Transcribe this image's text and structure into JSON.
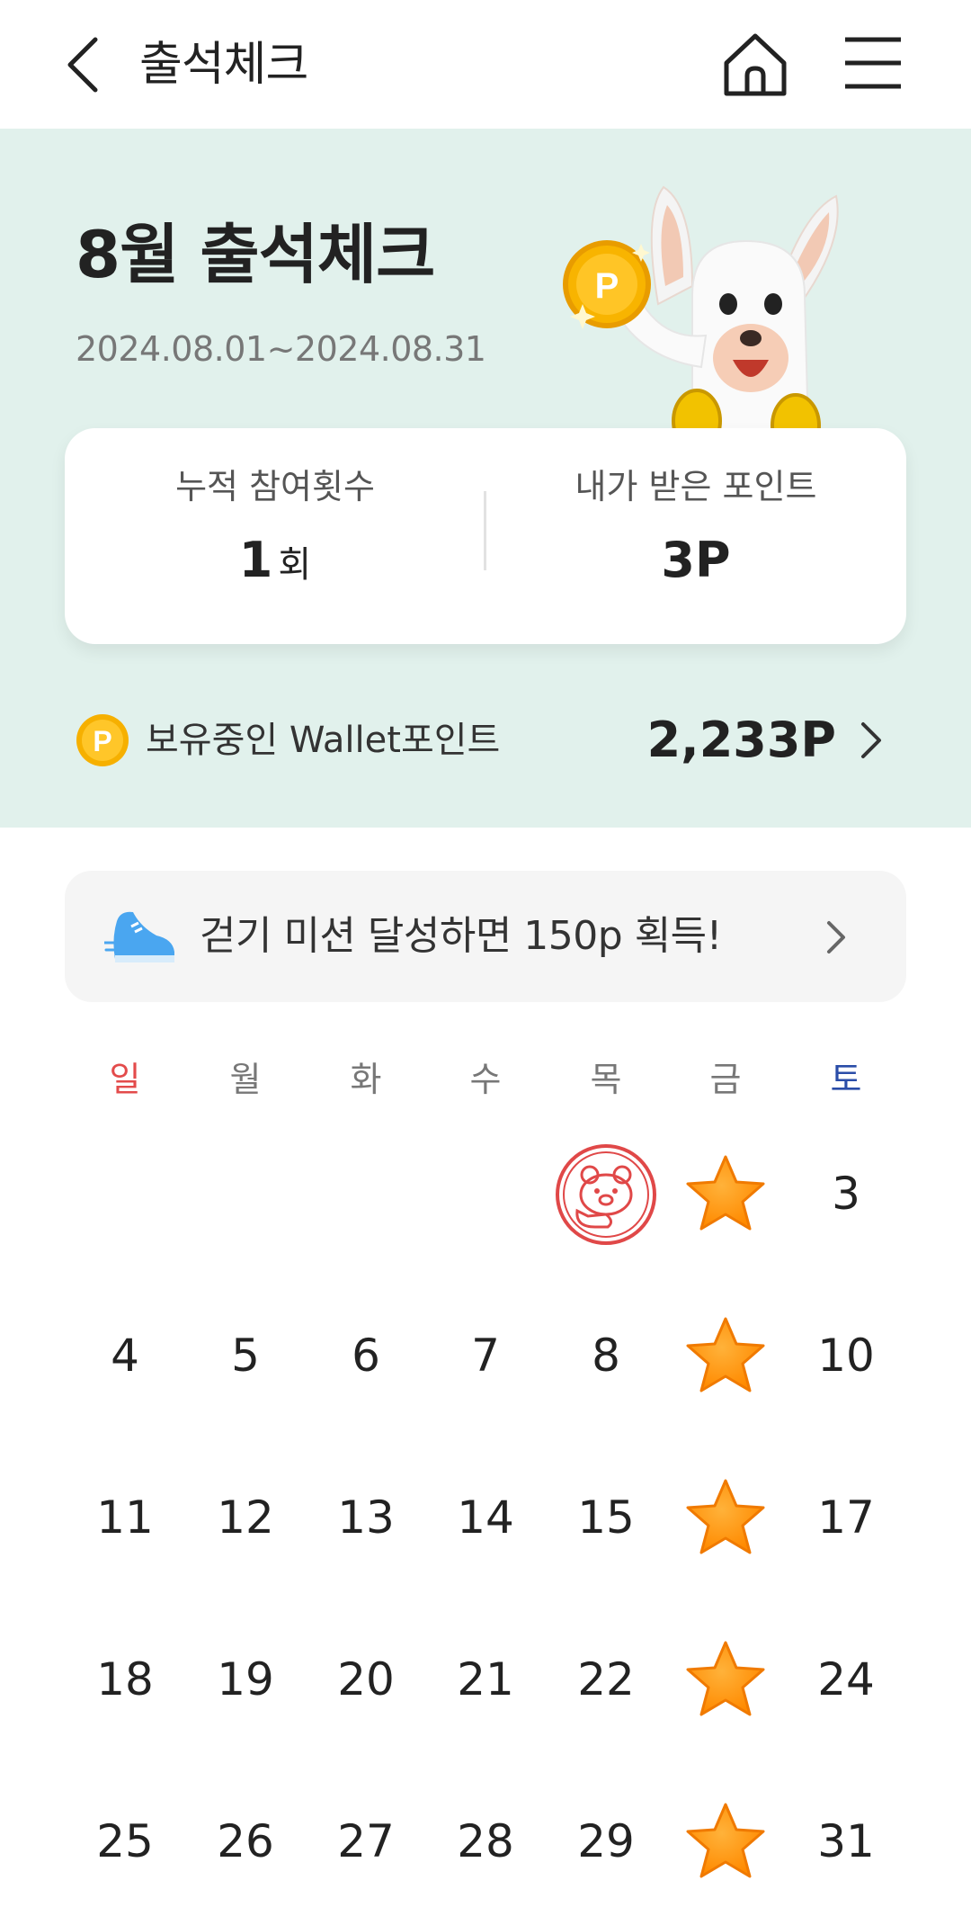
{
  "header": {
    "title": "출석체크",
    "back_icon": "chevron-left-icon",
    "home_icon": "home-icon",
    "menu_icon": "hamburger-menu-icon"
  },
  "hero": {
    "title": "8월 출석체크",
    "period": "2024.08.01~2024.08.31",
    "background_color": "#e1f1ec",
    "stats": {
      "participation_label": "누적 참여횟수",
      "participation_value": "1",
      "participation_unit": "회",
      "points_label": "내가 받은 포인트",
      "points_value": "3P"
    },
    "wallet": {
      "coin_letter": "P",
      "label": "보유중인 Wallet포인트",
      "amount": "2,233P"
    },
    "mascot_coin_letter": "P"
  },
  "banner": {
    "text": "걷기 미션 달성하면 150p 획득!",
    "icon": "sneaker-icon"
  },
  "calendar": {
    "weekdays": [
      "일",
      "월",
      "화",
      "수",
      "목",
      "금",
      "토"
    ],
    "weekday_colors": {
      "sunday": "#e34b4b",
      "saturday": "#2a4da8",
      "default": "#777777"
    },
    "weeks": [
      [
        {
          "t": "empty"
        },
        {
          "t": "empty"
        },
        {
          "t": "empty"
        },
        {
          "t": "empty"
        },
        {
          "t": "stamp"
        },
        {
          "t": "star"
        },
        {
          "t": "num",
          "v": "3"
        }
      ],
      [
        {
          "t": "num",
          "v": "4"
        },
        {
          "t": "num",
          "v": "5"
        },
        {
          "t": "num",
          "v": "6"
        },
        {
          "t": "num",
          "v": "7"
        },
        {
          "t": "num",
          "v": "8"
        },
        {
          "t": "star"
        },
        {
          "t": "num",
          "v": "10"
        }
      ],
      [
        {
          "t": "num",
          "v": "11"
        },
        {
          "t": "num",
          "v": "12"
        },
        {
          "t": "num",
          "v": "13"
        },
        {
          "t": "num",
          "v": "14"
        },
        {
          "t": "num",
          "v": "15"
        },
        {
          "t": "star"
        },
        {
          "t": "num",
          "v": "17"
        }
      ],
      [
        {
          "t": "num",
          "v": "18"
        },
        {
          "t": "num",
          "v": "19"
        },
        {
          "t": "num",
          "v": "20"
        },
        {
          "t": "num",
          "v": "21"
        },
        {
          "t": "num",
          "v": "22"
        },
        {
          "t": "star"
        },
        {
          "t": "num",
          "v": "24"
        }
      ],
      [
        {
          "t": "num",
          "v": "25"
        },
        {
          "t": "num",
          "v": "26"
        },
        {
          "t": "num",
          "v": "27"
        },
        {
          "t": "num",
          "v": "28"
        },
        {
          "t": "num",
          "v": "29"
        },
        {
          "t": "star"
        },
        {
          "t": "num",
          "v": "31"
        }
      ]
    ],
    "star_color": "#ff8a00",
    "stamp_color": "#e04848"
  }
}
